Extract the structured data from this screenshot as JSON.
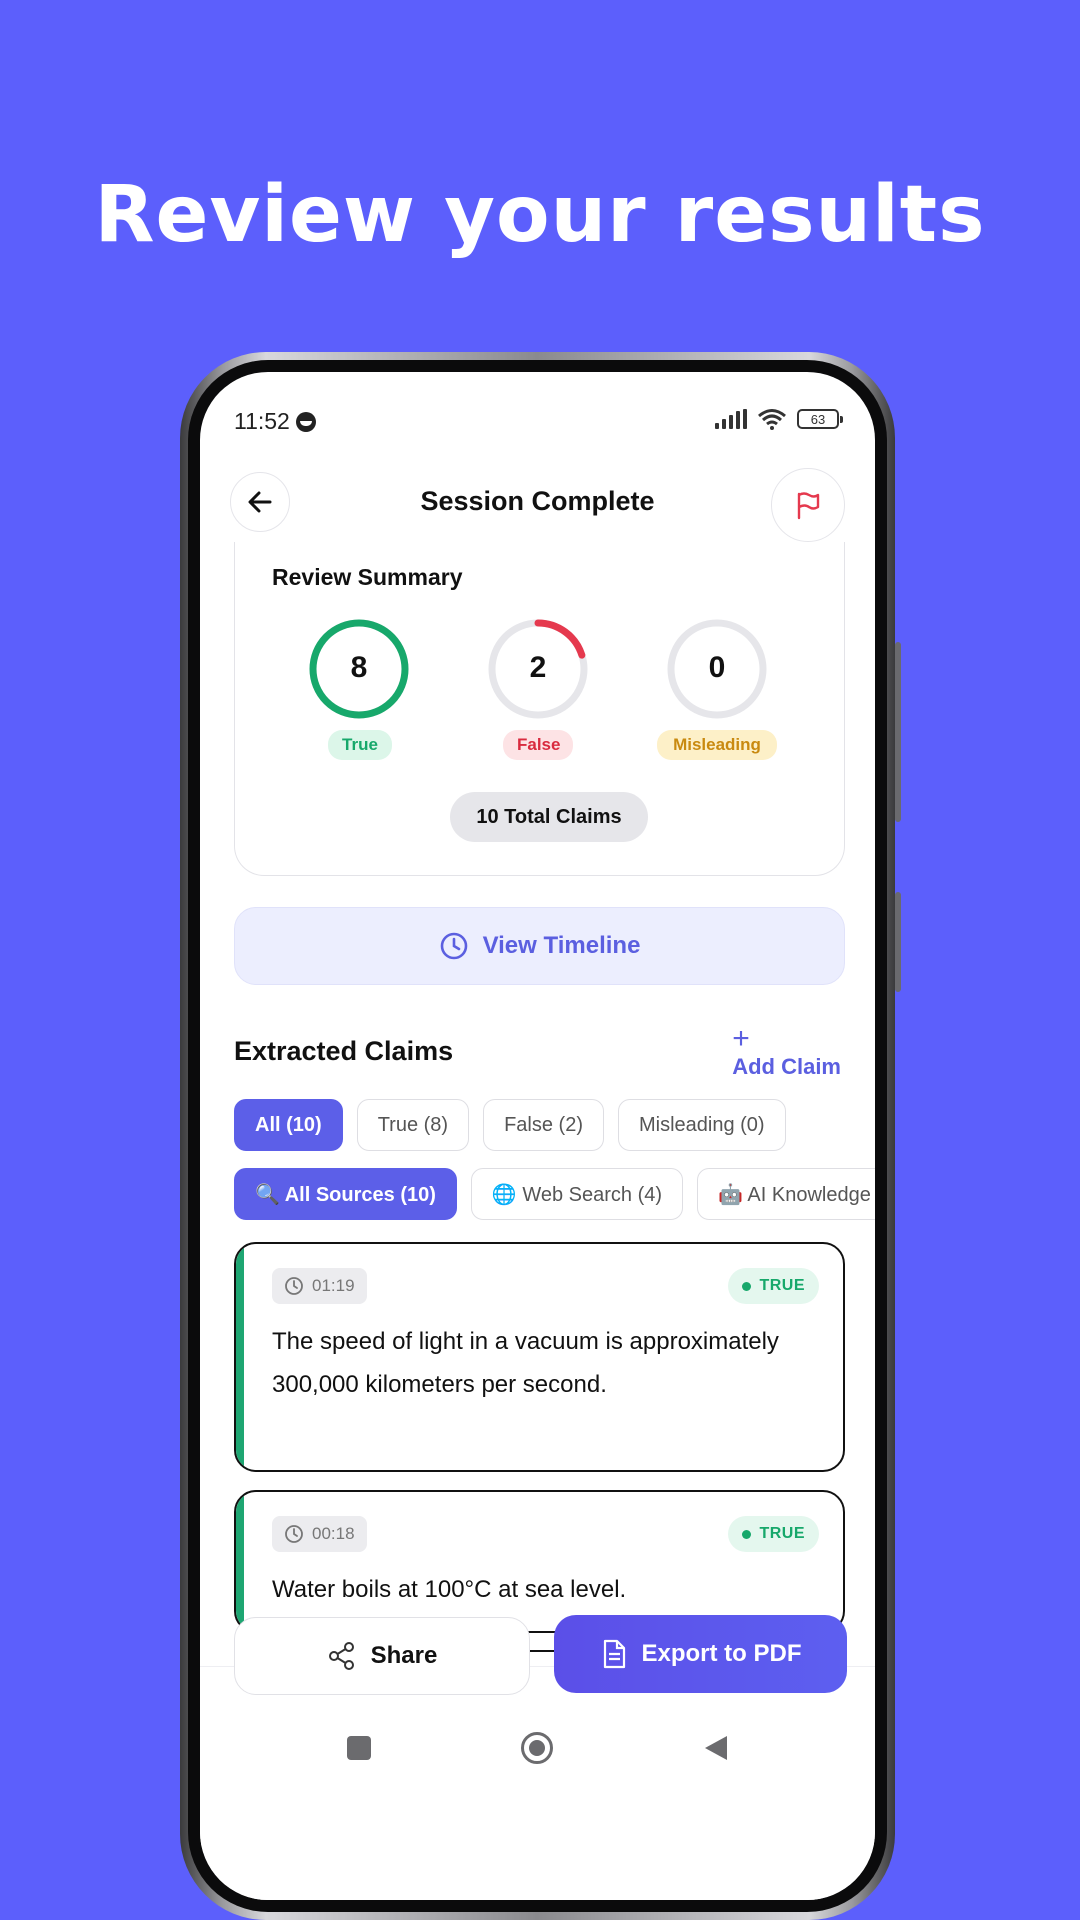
{
  "headline": "Review your results",
  "status": {
    "time": "11:52",
    "battery": "63"
  },
  "header": {
    "title": "Session Complete"
  },
  "summary": {
    "title": "Review Summary",
    "true_count": "8",
    "false_count": "2",
    "misleading_count": "0",
    "true_label": "True",
    "false_label": "False",
    "misleading_label": "Misleading",
    "total_label": "10 Total Claims"
  },
  "timeline": {
    "label": "View Timeline"
  },
  "claims": {
    "title": "Extracted Claims",
    "add_plus": "+",
    "add_label": "Add Claim",
    "filters": [
      "All (10)",
      "True (8)",
      "False (2)",
      "Misleading (0)"
    ],
    "sources": [
      "🔍 All Sources (10)",
      "🌐 Web Search (4)",
      "🤖 AI Knowledge"
    ],
    "items": [
      {
        "time": "01:19",
        "verdict": "TRUE",
        "text": "The speed of light in a vacuum is approximately 300,000 kilometers per second."
      },
      {
        "time": "00:18",
        "verdict": "TRUE",
        "text": "Water boils at 100°C at sea level."
      }
    ]
  },
  "actions": {
    "share": "Share",
    "export": "Export to PDF"
  },
  "colors": {
    "background": "#5c5ffc",
    "accent": "#5c5fe8",
    "true": "#17a86b",
    "false": "#e5394e",
    "misleading": "#c98a10"
  }
}
